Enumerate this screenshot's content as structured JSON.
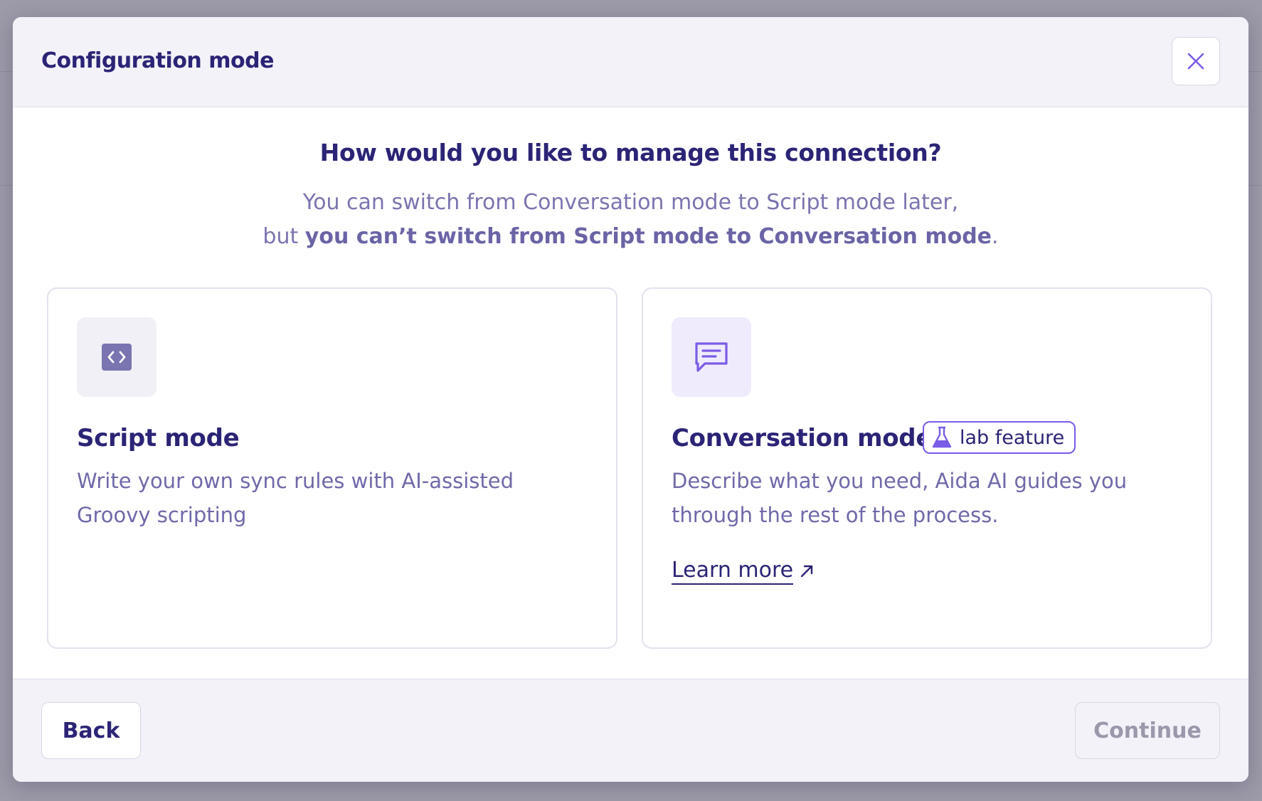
{
  "modal": {
    "title": "Configuration mode",
    "close_icon": "close-icon"
  },
  "body": {
    "question": "How would you like to manage this connection?",
    "subtitle_line1": "You can switch from Conversation mode to Script mode later,",
    "subtitle_line2_prefix": "but ",
    "subtitle_line2_bold": "you can’t switch from Script mode to Conversation mode",
    "subtitle_line2_suffix": "."
  },
  "cards": {
    "script": {
      "icon": "code-icon",
      "title": "Script mode",
      "description": "Write your own sync rules with AI-assisted Groovy scripting"
    },
    "conversation": {
      "icon": "chat-icon",
      "title": "Conversation mode",
      "badge_icon": "flask-icon",
      "badge": "lab feature",
      "description": "Describe what you need, Aida AI guides you through the rest of the process.",
      "learn_more": "Learn more",
      "learn_more_icon": "external-arrow-icon"
    }
  },
  "footer": {
    "back": "Back",
    "continue": "Continue"
  },
  "colors": {
    "primary_text": "#2b2476",
    "muted_text": "#7a74b0",
    "accent": "#7b5ce6"
  }
}
